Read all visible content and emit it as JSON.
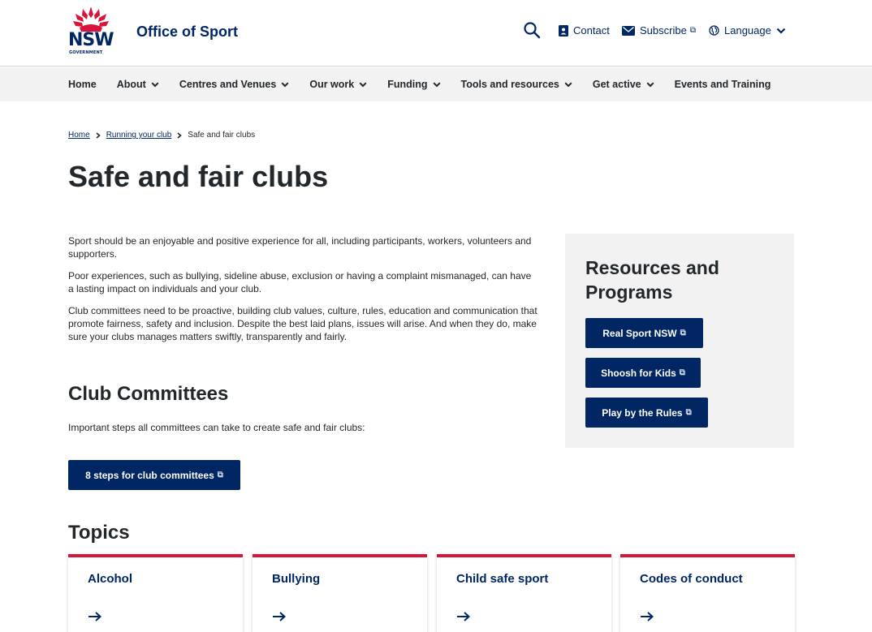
{
  "header": {
    "logo_text": "NSW",
    "logo_subtext": "GOVERNMENT",
    "site_title": "Office of Sport",
    "contact": "Contact",
    "subscribe": "Subscribe",
    "language": "Language",
    "external_glyph": "⧉"
  },
  "nav": {
    "items": [
      {
        "label": "Home",
        "has_dropdown": false
      },
      {
        "label": "About",
        "has_dropdown": true
      },
      {
        "label": "Centres and Venues",
        "has_dropdown": true
      },
      {
        "label": "Our work",
        "has_dropdown": true
      },
      {
        "label": "Funding",
        "has_dropdown": true
      },
      {
        "label": "Tools and resources",
        "has_dropdown": true
      },
      {
        "label": "Get active",
        "has_dropdown": true
      },
      {
        "label": "Events and Training",
        "has_dropdown": false
      }
    ]
  },
  "breadcrumb": {
    "home": "Home",
    "parent": "Running your club",
    "current": "Safe and fair clubs"
  },
  "page": {
    "title": "Safe and fair clubs",
    "paragraphs": [
      "Sport should be an enjoyable and positive experience for all, including participants, workers, volunteers and supporters.",
      "Poor experiences, such as bullying, sideline abuse, exclusion or having a complaint mismanaged, can have a lasting impact on individuals and your club.",
      "Club committees need to be proactive, building club values, culture, rules, education and communication that promote fairness, safety and inclusion. Despite the best laid plans, issues will arise. And when they do, make sure your clubs manages matters swiftly, transparently and fairly."
    ],
    "committees_heading": "Club Committees",
    "committees_text": "Important steps all committees can take to create safe and fair clubs:",
    "steps_button": "8 steps for club committees",
    "topics_heading": "Topics"
  },
  "sidebar": {
    "title": "Resources and Programs",
    "buttons": [
      "Real Sport NSW",
      "Shoosh for Kids",
      "Play by the Rules"
    ]
  },
  "topics": [
    {
      "title": "Alcohol"
    },
    {
      "title": "Bullying"
    },
    {
      "title": "Child safe sport"
    },
    {
      "title": "Codes of conduct"
    }
  ],
  "colors": {
    "brand_navy": "#002664",
    "accent_red": "#d7153a",
    "nav_bg": "#f2f2f2"
  }
}
